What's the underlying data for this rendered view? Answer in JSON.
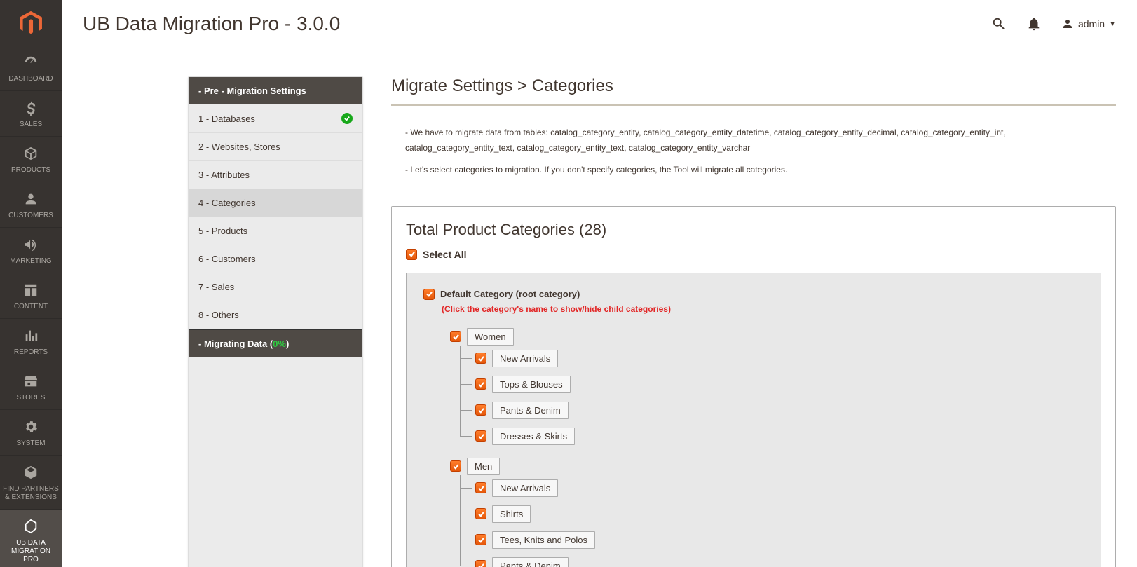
{
  "header": {
    "title": "UB Data Migration Pro - 3.0.0",
    "user": "admin"
  },
  "sidebar": {
    "items": [
      {
        "label": "DASHBOARD",
        "icon": "dashboard",
        "active": false
      },
      {
        "label": "SALES",
        "icon": "dollar",
        "active": false
      },
      {
        "label": "PRODUCTS",
        "icon": "cube",
        "active": false
      },
      {
        "label": "CUSTOMERS",
        "icon": "person",
        "active": false
      },
      {
        "label": "MARKETING",
        "icon": "megaphone",
        "active": false
      },
      {
        "label": "CONTENT",
        "icon": "layout",
        "active": false
      },
      {
        "label": "REPORTS",
        "icon": "bars",
        "active": false
      },
      {
        "label": "STORES",
        "icon": "store",
        "active": false
      },
      {
        "label": "SYSTEM",
        "icon": "gear",
        "active": false
      },
      {
        "label": "FIND PARTNERS & EXTENSIONS",
        "icon": "cube2",
        "active": false
      },
      {
        "label": "UB DATA MIGRATION PRO",
        "icon": "hex",
        "active": true
      }
    ]
  },
  "steps": {
    "header": "- Pre - Migration Settings",
    "items": [
      {
        "label": "1 - Databases",
        "done": true,
        "active": false
      },
      {
        "label": "2 - Websites, Stores",
        "done": false,
        "active": false
      },
      {
        "label": "3 - Attributes",
        "done": false,
        "active": false
      },
      {
        "label": "4 - Categories",
        "done": false,
        "active": true
      },
      {
        "label": "5 - Products",
        "done": false,
        "active": false
      },
      {
        "label": "6 - Customers",
        "done": false,
        "active": false
      },
      {
        "label": "7 - Sales",
        "done": false,
        "active": false
      },
      {
        "label": "8 - Others",
        "done": false,
        "active": false
      }
    ],
    "footer_prefix": "- Migrating Data (",
    "footer_percent": "0%",
    "footer_suffix": ")"
  },
  "main": {
    "section_title": "Migrate Settings > Categories",
    "info1": "- We have to migrate data from tables: catalog_category_entity, catalog_category_entity_datetime, catalog_category_entity_decimal, catalog_category_entity_int, catalog_category_entity_text, catalog_category_entity_text, catalog_category_entity_varchar",
    "info2": "- Let's select categories to migration. If you don't specify categories, the Tool will migrate all categories.",
    "cat_heading": "Total Product Categories (28)",
    "select_all": "Select All",
    "root_label": "Default Category (root category)",
    "hint": "(Click the category's name to show/hide child categories)",
    "tree": [
      {
        "name": "Women",
        "children": [
          {
            "name": "New Arrivals"
          },
          {
            "name": "Tops & Blouses"
          },
          {
            "name": "Pants & Denim"
          },
          {
            "name": "Dresses & Skirts"
          }
        ]
      },
      {
        "name": "Men",
        "children": [
          {
            "name": "New Arrivals"
          },
          {
            "name": "Shirts"
          },
          {
            "name": "Tees, Knits and Polos"
          },
          {
            "name": "Pants & Denim"
          }
        ]
      }
    ]
  }
}
